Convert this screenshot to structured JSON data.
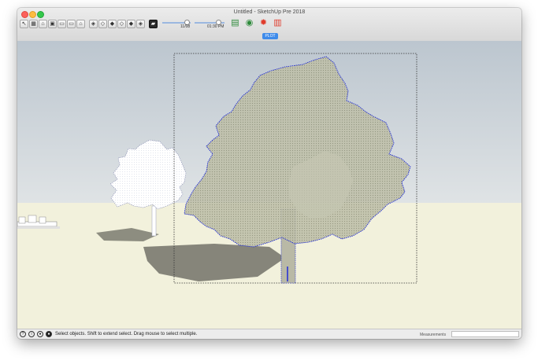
{
  "window": {
    "title": "Untitled - SketchUp Pre 2018"
  },
  "toolbar": {
    "left_tools": [
      {
        "name": "select-tool-icon",
        "glyph": "↖"
      },
      {
        "name": "component-icon",
        "glyph": "▦"
      },
      {
        "name": "home-view-icon",
        "glyph": "⌂"
      },
      {
        "name": "zoom-extents-icon",
        "glyph": "▣"
      },
      {
        "name": "previous-view-icon",
        "glyph": "▭"
      },
      {
        "name": "next-view-icon",
        "glyph": "▭"
      },
      {
        "name": "house-icon",
        "glyph": "⌂"
      },
      {
        "name": "iso-view-icon",
        "glyph": "◈"
      },
      {
        "name": "top-view-icon",
        "glyph": "◇"
      },
      {
        "name": "front-view-icon",
        "glyph": "◆"
      },
      {
        "name": "right-view-icon",
        "glyph": "◇"
      },
      {
        "name": "back-view-icon",
        "glyph": "◆"
      },
      {
        "name": "left-view-icon",
        "glyph": "◈"
      },
      {
        "name": "style-icon",
        "glyph": "▰"
      }
    ],
    "shadow_date": "11/08",
    "shadow_time": "01:30 PM",
    "date_fraction": 0.86,
    "time_fraction": 0.8,
    "right_tools": [
      {
        "name": "extension-warehouse-icon",
        "glyph": "▤",
        "color": "#2d8a3a"
      },
      {
        "name": "3d-warehouse-icon",
        "glyph": "◉",
        "color": "#2d8a3a"
      },
      {
        "name": "shadow-settings-icon",
        "glyph": "✹",
        "color": "#e03b2b"
      },
      {
        "name": "component-options-icon",
        "glyph": "▥",
        "color": "#e03b2b"
      }
    ]
  },
  "scene_tab": "PLOT",
  "status": {
    "message": "Select objects. Shift to extend select. Drag mouse to select multiple.",
    "measurements_label": "Measurements",
    "measurements_value": ""
  },
  "colors": {
    "sky": "#c4ccd3",
    "ground": "#f2f1dc",
    "selection": "#1f2bd9",
    "tree_fill": "#b7b9a3"
  }
}
